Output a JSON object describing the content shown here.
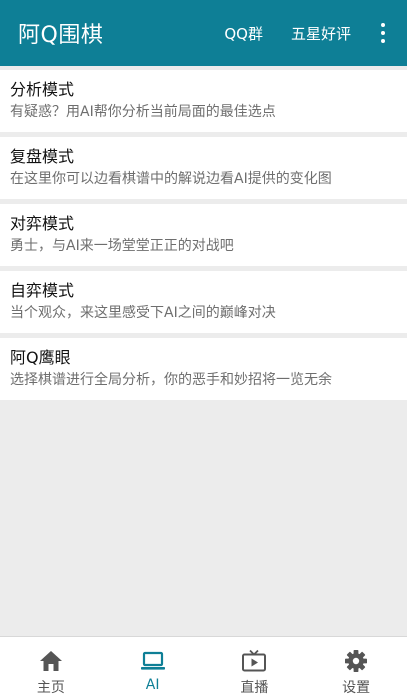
{
  "app_bar": {
    "title": "阿Q围棋",
    "actions": [
      "QQ群",
      "五星好评"
    ],
    "overflow_icon": "more-vertical-icon"
  },
  "modes": [
    {
      "title": "分析模式",
      "desc": "有疑惑？用AI帮你分析当前局面的最佳选点"
    },
    {
      "title": "复盘模式",
      "desc": "在这里你可以边看棋谱中的解说边看AI提供的变化图"
    },
    {
      "title": "对弈模式",
      "desc": "勇士，与AI来一场堂堂正正的对战吧"
    },
    {
      "title": "自弈模式",
      "desc": "当个观众，来这里感受下AI之间的巅峰对决"
    },
    {
      "title": "阿Q鹰眼",
      "desc": "选择棋谱进行全局分析，你的恶手和妙招将一览无余"
    }
  ],
  "bottom_nav": {
    "items": [
      {
        "label": "主页",
        "icon": "home-icon"
      },
      {
        "label": "AI",
        "icon": "laptop-icon"
      },
      {
        "label": "直播",
        "icon": "tv-icon"
      },
      {
        "label": "设置",
        "icon": "gear-icon"
      }
    ],
    "active": "AI"
  },
  "colors": {
    "primary": "#0e7f96",
    "background": "#ececec",
    "card": "#ffffff",
    "nav_inactive": "#555555"
  }
}
